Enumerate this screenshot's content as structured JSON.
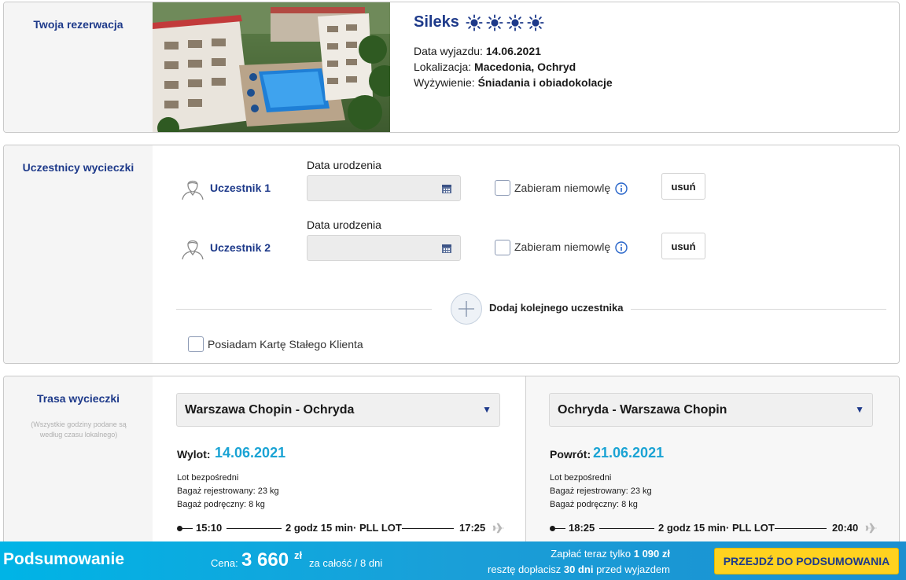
{
  "reservation": {
    "section_title": "Twoja rezerwacja",
    "hotel_name": "Sileks",
    "stars": 4,
    "departure_label": "Data wyjazdu:",
    "departure_value": "14.06.2021",
    "location_label": "Lokalizacja:",
    "location_value": "Macedonia, Ochryd",
    "meals_label": "Wyżywienie:",
    "meals_value": "Śniadania i obiadokolacje"
  },
  "participants": {
    "section_title": "Uczestnicy wycieczki",
    "items": [
      {
        "label": "Uczestnik 1",
        "dob_label": "Data urodzenia",
        "dob_value": "",
        "infant_label": "Zabieram niemowlę",
        "delete_label": "usuń"
      },
      {
        "label": "Uczestnik 2",
        "dob_label": "Data urodzenia",
        "dob_value": "",
        "infant_label": "Zabieram niemowlę",
        "delete_label": "usuń"
      }
    ],
    "add_label": "Dodaj kolejnego uczestnika",
    "loyalty_label": "Posiadam Kartę Stałego Klienta"
  },
  "route": {
    "section_title": "Trasa wycieczki",
    "note": "(Wszystkie godziny podane są według czasu lokalnego)",
    "outbound": {
      "select_value": "Warszawa Chopin - Ochryda",
      "date_label": "Wylot:",
      "date": "14.06.2021",
      "direct": "Lot bezpośredni",
      "checked_bag": "Bagaż rejestrowany: 23 kg",
      "hand_bag": "Bagaż podręczny: 8 kg",
      "dep_time": "15:10",
      "duration": "2 godz 15 min",
      "carrier": "· PLL LOT",
      "arr_time": "17:25"
    },
    "return": {
      "select_value": "Ochryda - Warszawa Chopin",
      "date_label": "Powrót:",
      "date": "21.06.2021",
      "direct": "Lot bezpośredni",
      "checked_bag": "Bagaż rejestrowany: 23 kg",
      "hand_bag": "Bagaż podręczny: 8 kg",
      "dep_time": "18:25",
      "duration": "2 godz 15 min",
      "carrier": "· PLL LOT",
      "arr_time": "20:40"
    }
  },
  "summary": {
    "title": "Podsumowanie",
    "price_label": "Cena:",
    "price": "3 660",
    "currency": "zł",
    "price_suffix": "za całość / 8 dni",
    "pay_now_prefix": "Zapłać teraz tylko",
    "pay_now_value": "1 090 zł",
    "rest_prefix": "resztę dopłacisz",
    "rest_days": "30 dni",
    "rest_suffix": "przed wyjazdem",
    "cta": "PRZEJDŹ DO PODSUMOWANIA"
  },
  "colors": {
    "brand_blue": "#1e3a8a",
    "accent_cyan": "#1aa3d4",
    "cta_yellow": "#ffd21f"
  }
}
